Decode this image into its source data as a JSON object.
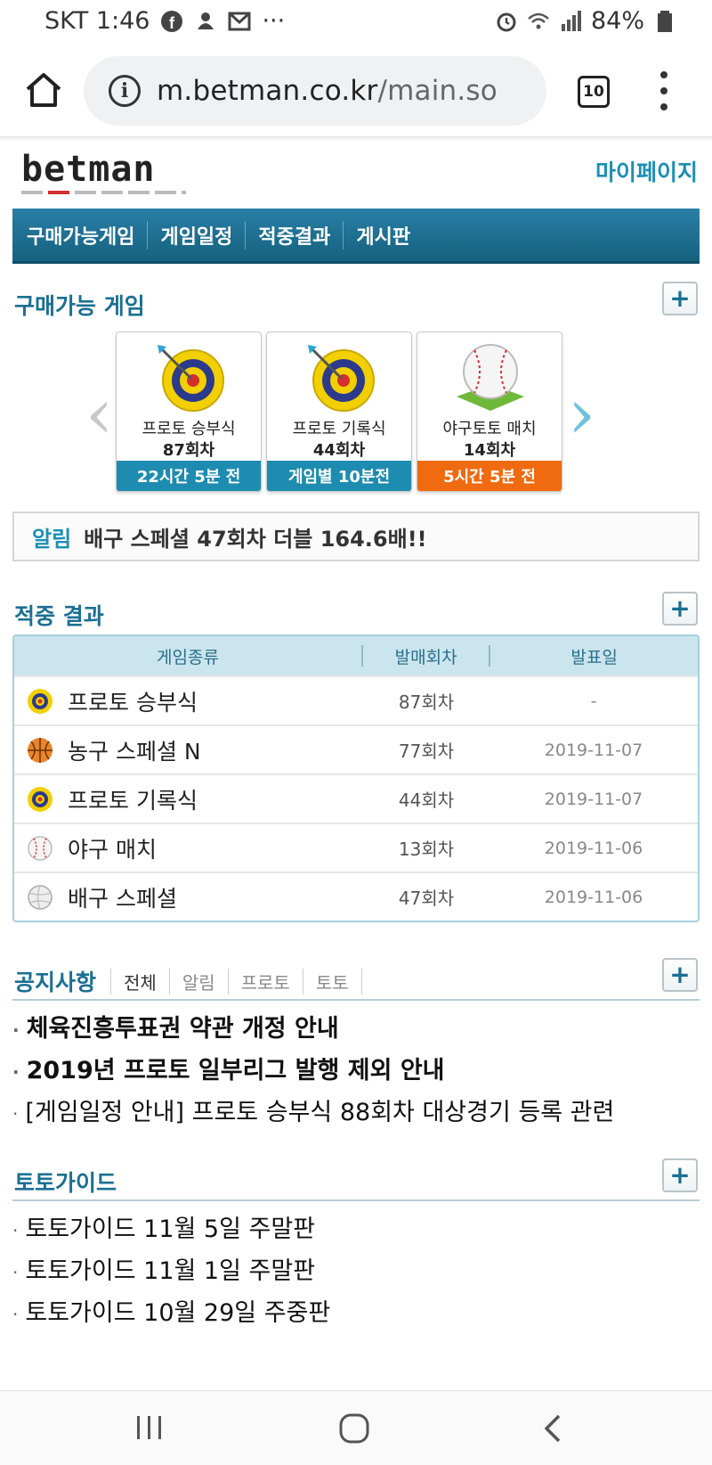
{
  "status": {
    "carrier_time": "SKT 1:46",
    "dots": "···",
    "battery": "84%"
  },
  "browser": {
    "url_host": "m.betman.co.kr",
    "url_path": "/main.so",
    "tab_count": "10"
  },
  "site": {
    "logo": "betman",
    "mypage": "마이페이지",
    "nav": [
      "구매가능게임",
      "게임일정",
      "적중결과",
      "게시판"
    ]
  },
  "buyable": {
    "title": "구매가능 게임",
    "plus": "+",
    "cards": [
      {
        "name": "프로토 승부식",
        "round": "87회차",
        "time": "22시간 5분 전",
        "time_color": "#1e8cb0"
      },
      {
        "name": "프로토 기록식",
        "round": "44회차",
        "time": "게임별 10분전",
        "time_color": "#1e8cb0"
      },
      {
        "name": "야구토토 매치",
        "round": "14회차",
        "time": "5시간 5분 전",
        "time_color": "#f06a10"
      }
    ]
  },
  "alert": {
    "label": "알림",
    "message": "배구 스페셜 47회차 더블 164.6배!!"
  },
  "results": {
    "title": "적중 결과",
    "plus": "+",
    "headers": [
      "게임종류",
      "발매회차",
      "발표일"
    ],
    "rows": [
      {
        "icon": "target-icon",
        "game": "프로토 승부식",
        "round": "87회차",
        "date": "-"
      },
      {
        "icon": "basketball-icon",
        "game": "농구 스페셜 N",
        "round": "77회차",
        "date": "2019-11-07"
      },
      {
        "icon": "target-icon",
        "game": "프로토 기록식",
        "round": "44회차",
        "date": "2019-11-07"
      },
      {
        "icon": "baseball-icon",
        "game": "야구 매치",
        "round": "13회차",
        "date": "2019-11-06"
      },
      {
        "icon": "volleyball-icon",
        "game": "배구 스페셜",
        "round": "47회차",
        "date": "2019-11-06"
      }
    ]
  },
  "notice": {
    "title": "공지사항",
    "plus": "+",
    "tabs": [
      "전체",
      "알림",
      "프로토",
      "토토"
    ],
    "items": [
      {
        "text": "체육진흥투표권 약관 개정 안내",
        "bold": true
      },
      {
        "text": "2019년 프로토 일부리그 발행 제외 안내",
        "bold": true
      },
      {
        "text": "[게임일정 안내] 프로토 승부식 88회차 대상경기 등록 관련",
        "bold": false
      }
    ]
  },
  "guide": {
    "title": "토토가이드",
    "plus": "+",
    "items": [
      "토토가이드 11월 5일 주말판",
      "토토가이드 11월 1일 주말판",
      "토토가이드 10월 29일 주중판"
    ]
  }
}
